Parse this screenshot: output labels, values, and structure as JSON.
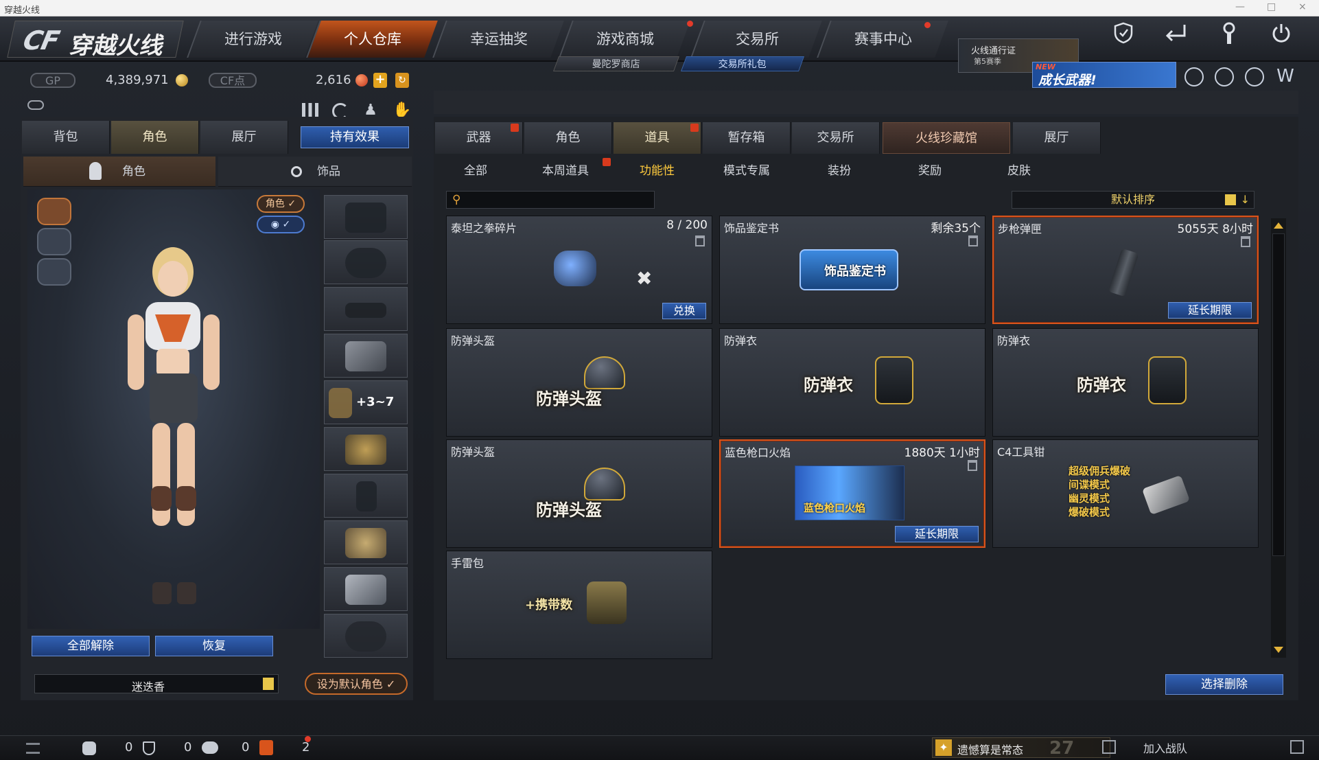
{
  "window": {
    "title": "穿越火线",
    "controls": [
      "—",
      "□",
      "×"
    ]
  },
  "logo": {
    "cf": "CF",
    "cn": "穿越火线"
  },
  "nav": {
    "tabs": [
      {
        "label": "进行游戏"
      },
      {
        "label": "个人仓库"
      },
      {
        "label": "幸运抽奖"
      },
      {
        "label": "游戏商城"
      },
      {
        "label": "交易所"
      },
      {
        "label": "赛事中心"
      }
    ],
    "sub": [
      {
        "label": "曼陀罗商店"
      },
      {
        "label": "交易所礼包"
      }
    ],
    "pass": {
      "line1": "火线通行证",
      "line2": "第5赛季",
      "level": "5"
    }
  },
  "currency": {
    "gp_label": "GP",
    "gp_value": "4,389,971",
    "cf_label": "CF点",
    "cf_value": "2,616",
    "plus": "+"
  },
  "promo": {
    "new": "NEW",
    "text": "成长武器!"
  },
  "left": {
    "tabs": [
      {
        "label": "背包"
      },
      {
        "label": "角色"
      },
      {
        "label": "展厅"
      }
    ],
    "effect_button": "持有效果",
    "subtabs": [
      {
        "label": "角色"
      },
      {
        "label": "饰品"
      }
    ],
    "toggles": [
      {
        "label": "角色 ✓"
      },
      {
        "label": "◉ ✓"
      }
    ],
    "slot_overlay": "+3~7",
    "unequip_all": "全部解除",
    "restore": "恢复",
    "character_name": "迷迭香",
    "set_default": "设为默认角色 ✓"
  },
  "right": {
    "tabs": [
      {
        "label": "武器"
      },
      {
        "label": "角色"
      },
      {
        "label": "道具"
      },
      {
        "label": "暂存箱"
      },
      {
        "label": "交易所"
      },
      {
        "label": "火线珍藏馆"
      },
      {
        "label": "展厅"
      }
    ],
    "subtabs": [
      {
        "label": "全部"
      },
      {
        "label": "本周道具"
      },
      {
        "label": "功能性"
      },
      {
        "label": "模式专属"
      },
      {
        "label": "装扮"
      },
      {
        "label": "奖励"
      },
      {
        "label": "皮肤"
      }
    ],
    "search_placeholder": "",
    "sort": "默认排序",
    "items": [
      {
        "title": "泰坦之拳碎片",
        "extra": "8 / 200",
        "action": "兑换"
      },
      {
        "title": "饰品鉴定书",
        "extra": "剩余35个",
        "art_text": "饰品鉴定书"
      },
      {
        "title": "步枪弹匣",
        "extra": "5055天 8小时",
        "action": "延长期限"
      },
      {
        "title": "防弹头盔",
        "art_text": "防弹头盔"
      },
      {
        "title": "防弹衣",
        "art_text": "防弹衣"
      },
      {
        "title": "防弹衣",
        "art_text": "防弹衣"
      },
      {
        "title": "防弹头盔",
        "art_text": "防弹头盔"
      },
      {
        "title": "蓝色枪口火焰",
        "extra": "1880天 1小时",
        "action": "延长期限",
        "art_text": "蓝色枪口火焰"
      },
      {
        "title": "C4工具钳",
        "art_lines": [
          "超级佣兵爆破",
          "间谍模式",
          "幽灵模式",
          "爆破模式"
        ]
      },
      {
        "title": "手雷包",
        "art_text": "+携带数"
      }
    ],
    "bulk_delete": "选择删除"
  },
  "status": {
    "counts": [
      "0",
      "0",
      "0",
      "2"
    ],
    "news": "遗憾算是常态",
    "join": "加入战队",
    "season_no": "27"
  },
  "colors": {
    "accent_orange": "#d8541c",
    "button_blue": "#2f5eae",
    "gold": "#ffcb3d"
  }
}
